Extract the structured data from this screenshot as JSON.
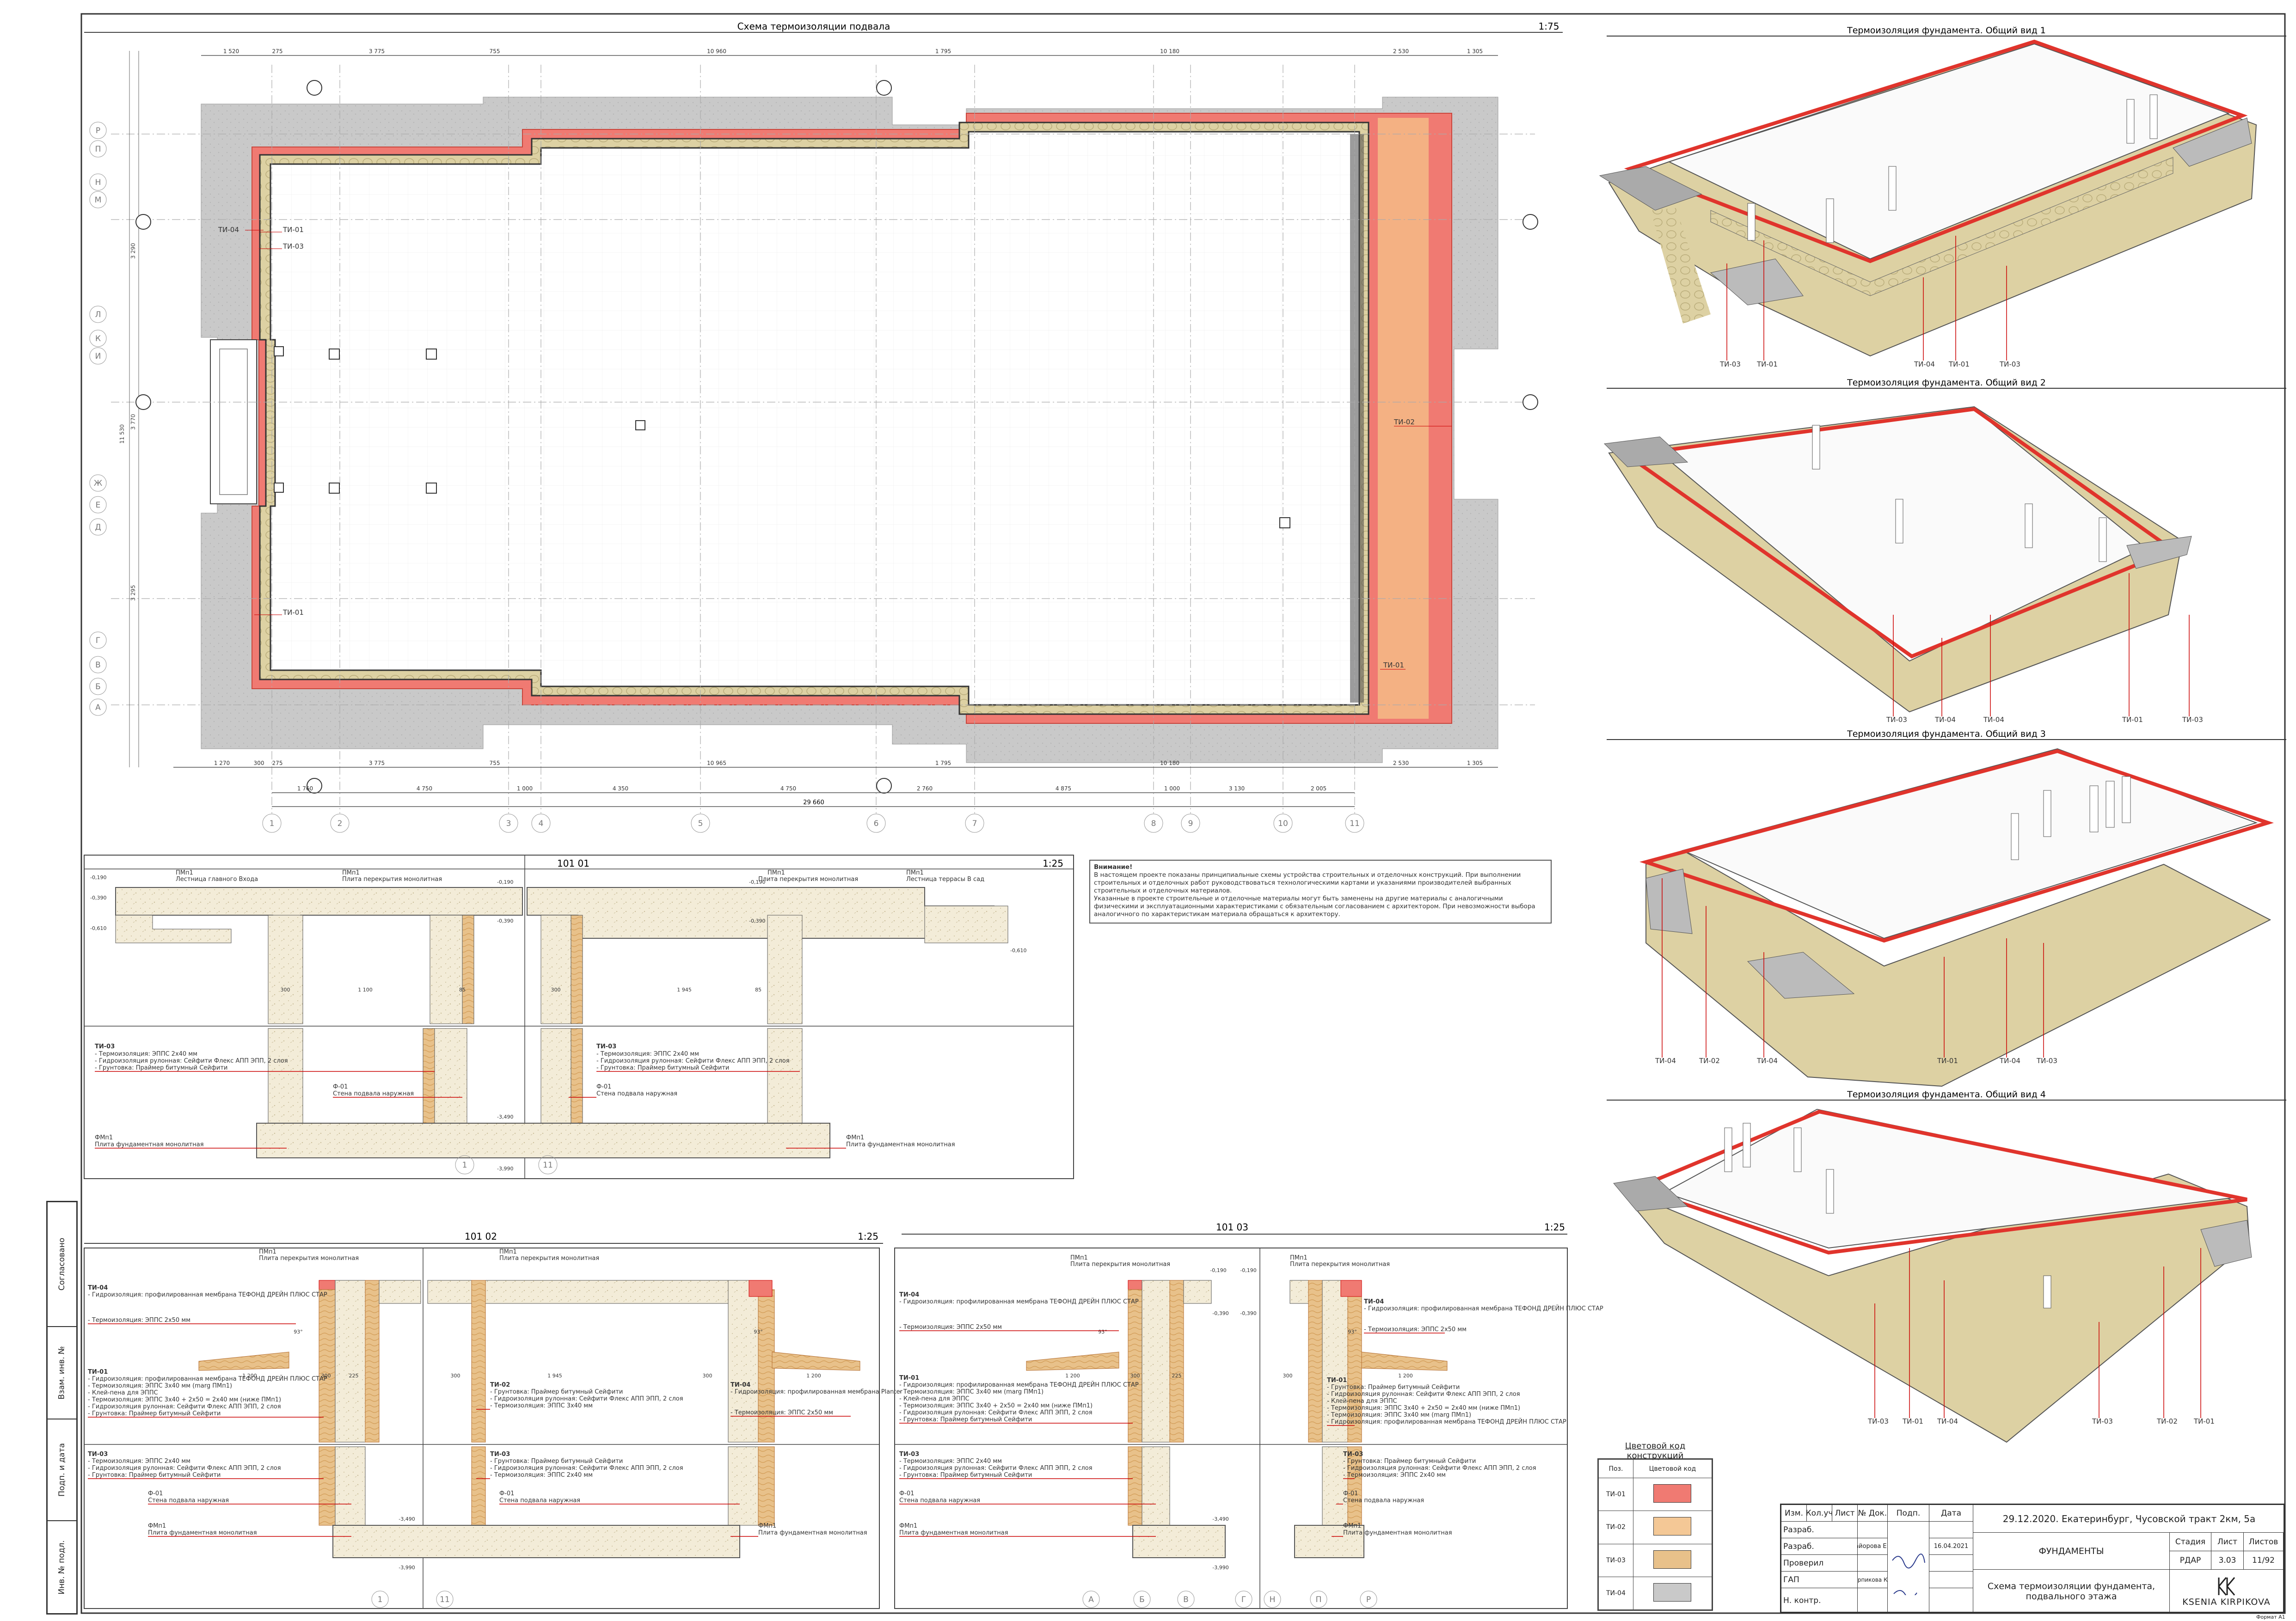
{
  "plan": {
    "title": "Схема термоизоляции подвала",
    "scale": "1:75",
    "dims_top": [
      "1 520",
      "275",
      "3 775",
      "755",
      "10 960",
      "1 795",
      "10 180",
      "2 530",
      "1 305"
    ],
    "dims_bottom_1": [
      "1 270",
      "300",
      "275",
      "3 775",
      "755",
      "10 965",
      "1 795",
      "10 180",
      "2 530",
      "1 305"
    ],
    "dims_bottom_2": [
      "1 760",
      "4 750",
      "1 000",
      "4 350",
      "4 750",
      "2 760",
      "4 875",
      "1 000",
      "3 130",
      "2 005"
    ],
    "dims_total": "29 660",
    "axes_x": [
      "1",
      "2",
      "3",
      "4",
      "5",
      "6",
      "7",
      "8",
      "9",
      "10",
      "11"
    ],
    "axes_y": [
      "Р",
      "П",
      "Н",
      "М",
      "Л",
      "К",
      "И",
      "Ж",
      "Е",
      "Д",
      "Г",
      "В",
      "Б",
      "А"
    ],
    "dims_left": [
      "3 290",
      "11 530",
      "3 770",
      "3 295"
    ],
    "tags": [
      "ТИ-04",
      "ТИ-01",
      "ТИ-03",
      "ТИ-01",
      "ТИ-02",
      "ТИ-01"
    ]
  },
  "views": [
    {
      "title": "Термоизоляция фундамента. Общий вид 1",
      "tags": [
        "ТИ-03",
        "ТИ-01",
        "ТИ-04",
        "ТИ-01",
        "ТИ-03"
      ]
    },
    {
      "title": "Термоизоляция фундамента. Общий вид 2",
      "tags": [
        "ТИ-03",
        "ТИ-04",
        "ТИ-04",
        "ТИ-01",
        "ТИ-03"
      ]
    },
    {
      "title": "Термоизоляция фундамента. Общий вид 3",
      "tags": [
        "ТИ-04",
        "ТИ-02",
        "ТИ-04",
        "ТИ-01",
        "ТИ-04",
        "ТИ-03"
      ]
    },
    {
      "title": "Термоизоляция фундамента. Общий вид 4",
      "tags": [
        "ТИ-03",
        "ТИ-01",
        "ТИ-04",
        "ТИ-03",
        "ТИ-02",
        "ТИ-01"
      ]
    }
  ],
  "section_101_01": {
    "title": "101 01",
    "scale": "1:25",
    "labels": [
      "ПМп1",
      "Лестница главного Входа",
      "ПМп1",
      "Плита перекрытия монолитная",
      "ПМп1",
      "Плита перекрытия монолитная",
      "ПМп1",
      "Лестница террасы В сад"
    ],
    "levels": [
      "-0,190",
      "-0,390",
      "-0,610",
      "-0,190",
      "-0,390",
      "-0,190",
      "-0,390",
      "-0,610",
      "-3,490",
      "-3,990"
    ],
    "dims": [
      "300",
      "1 100",
      "85",
      "300",
      "1 945",
      "85"
    ],
    "axes": [
      "1",
      "11"
    ],
    "note_left": {
      "tag": "ТИ-03",
      "lines": [
        "- Термоизоляция: ЭППС 2х40 мм",
        "- Гидроизоляция рулонная: Сейфити Флекс АПП ЭПП, 2 слоя",
        "- Грунтовка: Праймер битумный Сейфити"
      ]
    },
    "note_right": {
      "tag": "ТИ-03",
      "lines": [
        "- Термоизоляция: ЭППС 2х40 мм",
        "- Гидроизоляция рулонная: Сейфити Флекс АПП ЭПП, 2 слоя",
        "- Грунтовка: Праймер битумный Сейфити"
      ]
    },
    "wall": [
      "Ф-01",
      "Стена подвала наружная",
      "Ф-01",
      "Стена подвала наружная"
    ],
    "slab": [
      "ФМп1",
      "Плита фундаментная монолитная",
      "ФМп1",
      "Плита фундаментная монолитная"
    ]
  },
  "section_101_02": {
    "title": "101 02",
    "scale": "1:25",
    "top_labels": [
      "ПМп1",
      "Плита перекрытия монолитная",
      "ПМп1",
      "Плита перекрытия монолитная"
    ],
    "ti04": {
      "tag": "ТИ-04",
      "lines": [
        "- Гидроизоляция: профилированная мембрана ТЕФОНД ДРЕЙН ПЛЮС СТАР",
        "- Термоизоляция: ЭППС 2х50 мм"
      ]
    },
    "ti01": {
      "tag": "ТИ-01",
      "lines": [
        "- Гидроизоляция: профилированная мембрана ТЕФОНД ДРЕЙН ПЛЮС СТАР",
        "- Термоизоляция: ЭППС 3х40 мм (marg ПМп1)",
        "- Клей-пена для ЭППС",
        "- Термоизоляция: ЭППС 3х40 + 2х50 = 2х40 мм (ниже ПМп1)",
        "- Гидроизоляция рулонная: Сейфити Флекс АПП ЭПП, 2 слоя",
        "- Грунтовка: Праймер битумный Сейфити"
      ]
    },
    "ti02": {
      "tag": "ТИ-02",
      "lines": [
        "- Грунтовка: Праймер битумный Сейфити",
        "- Гидроизоляция рулонная: Сейфити Флекс АПП ЭПП, 2 слоя",
        "- Термоизоляция: ЭППС 3х40 мм"
      ]
    },
    "ti04r": {
      "tag": "ТИ-04",
      "lines": [
        "- Гидроизоляция: профилированная мембрана Planter",
        "- Термоизоляция: ЭППС 2х50 мм"
      ]
    },
    "ti03a": {
      "tag": "ТИ-03",
      "lines": [
        "- Термоизоляция: ЭППС 2х40 мм",
        "- Гидроизоляция рулонная: Сейфити Флекс АПП ЭПП, 2 слоя",
        "- Грунтовка: Праймер битумный Сейфити"
      ]
    },
    "ti03b": {
      "tag": "ТИ-03",
      "lines": [
        "- Грунтовка: Праймер битумный Сейфити",
        "- Гидроизоляция рулонная: Сейфити Флекс АПП ЭПП, 2 слоя",
        "- Термоизоляция: ЭППС 2х40 мм"
      ]
    },
    "wall": [
      "Ф-01",
      "Стена подвала наружная",
      "Ф-01",
      "Стена подвала наружная"
    ],
    "slab": [
      "ФМп1",
      "Плита фундаментная монолитная",
      "ФМп1",
      "Плита фундаментная монолитная"
    ],
    "dims": [
      "1 200",
      "300",
      "225",
      "300",
      "1 945",
      "300",
      "1 200"
    ],
    "angles": [
      "93°",
      "93°"
    ],
    "levels": [
      "-3,490",
      "-3,990"
    ],
    "axes": [
      "1",
      "11"
    ]
  },
  "section_101_03": {
    "title": "101 03",
    "scale": "1:25",
    "top_labels": [
      "ПМп1",
      "Плита перекрытия монолитная",
      "ПМп1",
      "Плита перекрытия монолитная"
    ],
    "ti04": {
      "tag": "ТИ-04",
      "lines": [
        "- Гидроизоляция: профилированная мембрана ТЕФОНД ДРЕЙН ПЛЮС СТАР",
        "- Термоизоляция: ЭППС 2х50 мм"
      ]
    },
    "ti01": {
      "tag": "ТИ-01",
      "lines": [
        "- Гидроизоляция: профилированная мембрана ТЕФОНД ДРЕЙН ПЛЮС СТАР",
        "- Термоизоляция: ЭППС 3х40 мм (marg ПМп1)",
        "- Клей-пена для ЭППС",
        "- Термоизоляция: ЭППС 3х40 + 2х50 = 2х40 мм (ниже ПМп1)",
        "- Гидроизоляция рулонная: Сейфити Флекс АПП ЭПП, 2 слоя",
        "- Грунтовка: Праймер битумный Сейфити"
      ]
    },
    "ti04r": {
      "tag": "ТИ-04",
      "lines": [
        "- Гидроизоляция: профилированная мембрана ТЕФОНД ДРЕЙН ПЛЮС СТАР",
        "- Термоизоляция: ЭППС 2х50 мм"
      ]
    },
    "ti01r": {
      "tag": "ТИ-01",
      "lines": [
        "- Грунтовка: Праймер битумный Сейфити",
        "- Гидроизоляция рулонная: Сейфити Флекс АПП ЭПП, 2 слоя",
        "- Клей-пена для ЭППС",
        "- Термоизоляция: ЭППС 3х40 + 2х50 = 2х40 мм (ниже ПМп1)",
        "- Термоизоляция: ЭППС 3х40 мм (marg ПМп1)",
        "- Гидроизоляция: профилированная мембрана ТЕФОНД ДРЕЙН ПЛЮС СТАР"
      ]
    },
    "ti03a": {
      "tag": "ТИ-03",
      "lines": [
        "- Термоизоляция: ЭППС 2х40 мм",
        "- Гидроизоляция рулонная: Сейфити Флекс АПП ЭПП, 2 слоя",
        "- Грунтовка: Праймер битумный Сейфити"
      ]
    },
    "ti03b": {
      "tag": "ТИ-03",
      "lines": [
        "- Грунтовка: Праймер битумный Сейфити",
        "- Гидроизоляция рулонная: Сейфити Флекс АПП ЭПП, 2 слоя",
        "- Термоизоляция: ЭППС 2х40 мм"
      ]
    },
    "wall": [
      "Ф-01",
      "Стена подвала наружная",
      "Ф-01",
      "Стена подвала наружная"
    ],
    "slab": [
      "ФМп1",
      "Плита фундаментная монолитная",
      "ФМп1",
      "Плита фундаментная монолитная"
    ],
    "levels": [
      "-0,190",
      "-0,390",
      "-0,190",
      "-0,390",
      "-3,490",
      "-3,990"
    ],
    "angles": [
      "93°",
      "93°"
    ],
    "dims": [
      "1 200",
      "300",
      "225",
      "300",
      "1 200"
    ],
    "axes": [
      "А",
      "Б",
      "В",
      "Г",
      "Н",
      "П",
      "Р"
    ]
  },
  "notes": {
    "title": "Внимание!",
    "lines": [
      "В настоящем проекте показаны принципиальные схемы устройства строительных и отделочных конструкций. При выполнении",
      "строительных и отделочных работ руководствоваться технологическими картами и указаниями производителей выбранных",
      "строительных и отделочных материалов.",
      "Указанные в проекте строительные и отделочные материалы могут быть заменены на другие материалы с аналогичными",
      "физическими и эксплуатационными характеристиками с обязательным согласованием с архитектором. При невозможности выбора",
      "аналогичного по характеристикам материала обращаться к архитектору."
    ]
  },
  "legend": {
    "title": "Цветовой код конструкций",
    "head": [
      "Поз.",
      "Цветовой код"
    ],
    "rows": [
      "ТИ-01",
      "ТИ-02",
      "ТИ-03",
      "ТИ-04"
    ]
  },
  "stamp": {
    "head": [
      "Изм.",
      "Кол.уч",
      "Лист",
      "№ Док.",
      "Подп.",
      "Дата"
    ],
    "roles": [
      "Разраб.",
      "Разраб.",
      "Проверил",
      "ГАП",
      "Н. контр."
    ],
    "names": [
      "",
      "Майорова Е.О.",
      "",
      "Кирпикова К.С.",
      ""
    ],
    "dates": [
      "",
      "16.04.2021",
      "",
      "",
      ""
    ],
    "project": "29.12.2020. Екатеринбург, Чусовской тракт 2км, 5а",
    "section": "ФУНДАМЕНТЫ",
    "sheet_title": "Схема термоизоляции фундамента, подвального этажа",
    "stage_head": [
      "Стадия",
      "Лист",
      "Листов"
    ],
    "stage": [
      "РДАР",
      "3.03",
      "11/92"
    ],
    "company": "KSENIA KIRPIKOVA",
    "format": "Формат А1"
  },
  "side_block": [
    "Согласовано",
    "Взам. инв. №",
    "Подп. и дата",
    "Инв. № подл."
  ]
}
